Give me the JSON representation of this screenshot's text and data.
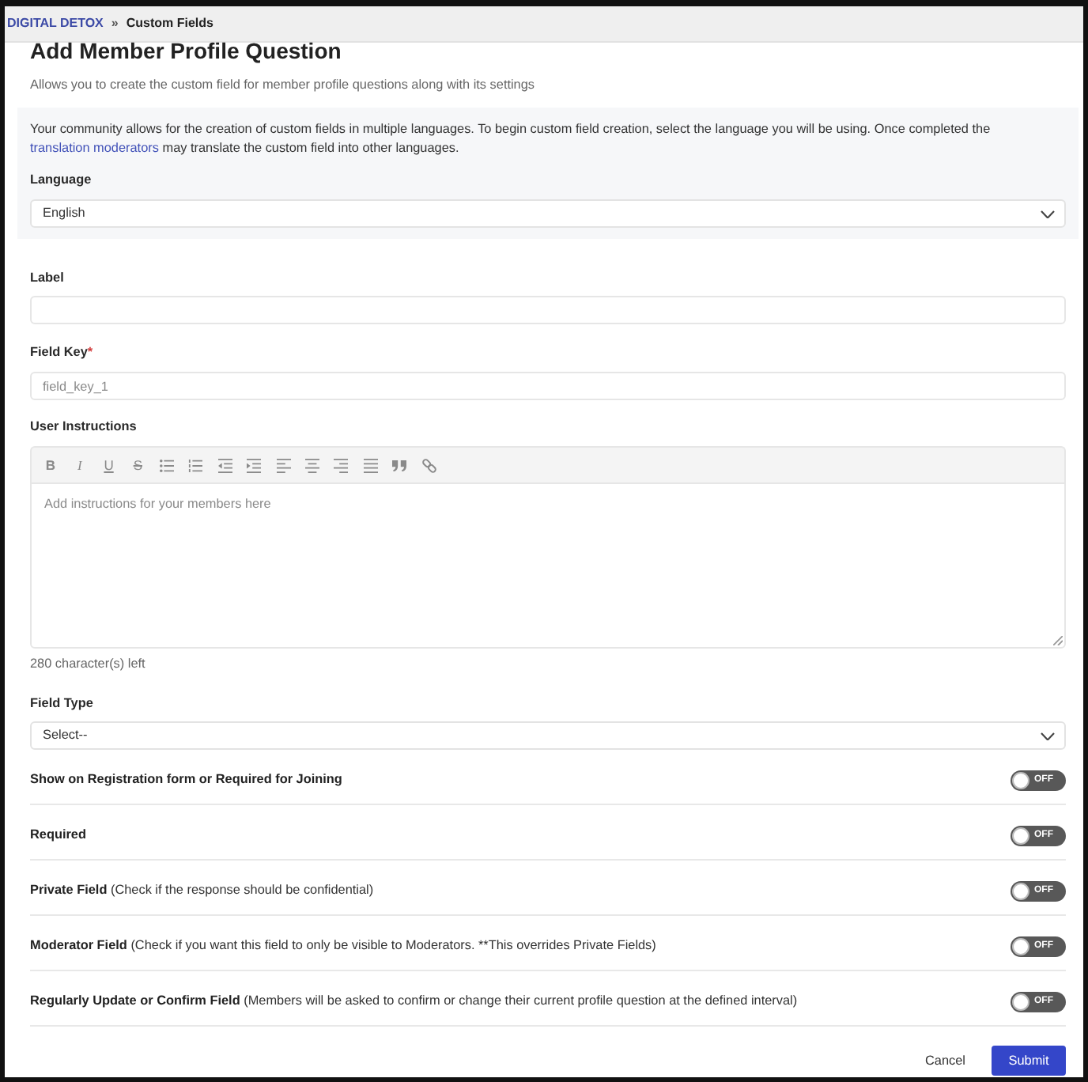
{
  "breadcrumb": {
    "separator": "»",
    "items": [
      {
        "kind": "link",
        "label": "DIGITAL DETOX"
      },
      {
        "kind": "current",
        "label": "Custom Fields"
      }
    ]
  },
  "header": {
    "title": "Add Member Profile Question",
    "subtitle": "Allows you to create the custom field for member profile questions along with its settings"
  },
  "language_panel": {
    "text_before": "Your community allows for the creation of custom fields in multiple languages. To begin custom field creation, select the language you will be using. Once completed the",
    "link": "translation moderators",
    "text_after": "may translate the custom field into other languages.",
    "label": "Language",
    "value": "English"
  },
  "label_field": {
    "label": "Label"
  },
  "field_key": {
    "label": "Field Key",
    "required_mark": "*",
    "placeholder": "field_key_1"
  },
  "user_instructions": {
    "label": "User Instructions",
    "toolbar": [
      {
        "kind": "bold",
        "text": "B"
      },
      {
        "kind": "italic",
        "text": "I"
      },
      {
        "kind": "underline",
        "text": "U"
      },
      {
        "kind": "strikethrough",
        "text": "S"
      },
      {
        "kind": "bullet-list"
      },
      {
        "kind": "numbered-list"
      },
      {
        "kind": "outdent"
      },
      {
        "kind": "indent"
      },
      {
        "kind": "align-left"
      },
      {
        "kind": "align-center"
      },
      {
        "kind": "align-right"
      },
      {
        "kind": "justify"
      },
      {
        "kind": "quote"
      },
      {
        "kind": "link"
      }
    ],
    "placeholder": "Add instructions for your members here",
    "counter": "280 character(s) left"
  },
  "field_type": {
    "label": "Field Type",
    "value": "Select--"
  },
  "toggles": [
    {
      "label": "Show on Registration form or Required for Joining",
      "on": false,
      "state_text": "OFF"
    },
    {
      "label": "Required",
      "on": false,
      "state_text": "OFF"
    },
    {
      "label": "Private Field",
      "note": "(Check if the response should be confidential)",
      "on": false,
      "state_text": "OFF"
    },
    {
      "label": "Moderator Field",
      "note": "(Check if you want this field to only be visible to Moderators. **This overrides Private Fields)",
      "on": false,
      "state_text": "OFF"
    },
    {
      "label": "Regularly Update or Confirm Field",
      "note": "(Members will be asked to confirm or change their current profile question at the defined interval)",
      "on": false,
      "state_text": "OFF"
    }
  ],
  "actions": {
    "cancel": "Cancel",
    "submit": "Submit"
  }
}
